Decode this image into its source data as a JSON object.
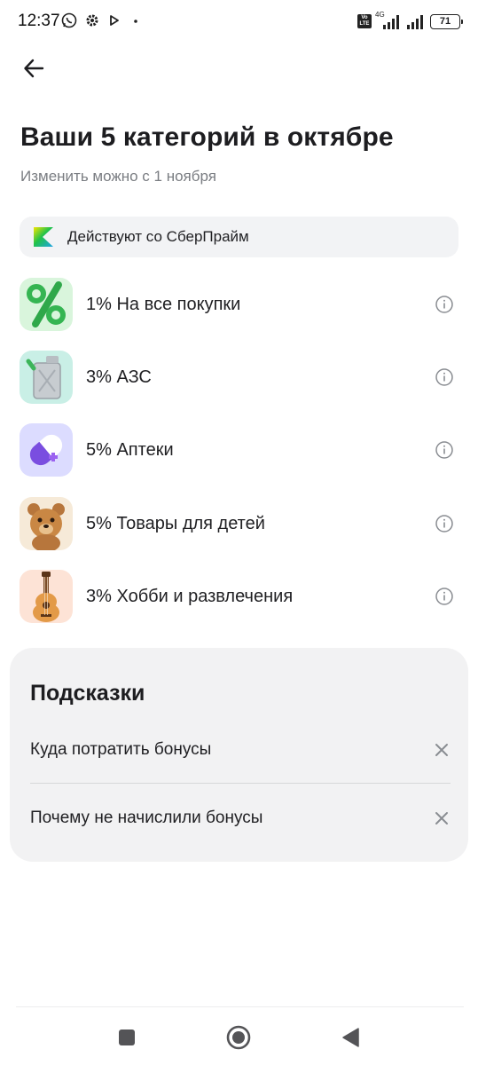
{
  "status_bar": {
    "time": "12:37",
    "network": "4G",
    "volte": "Vo LTE",
    "battery": "71",
    "icons": [
      "whatsapp-icon",
      "gear-icon",
      "play-icon",
      "dot-icon",
      "volte-icon",
      "signal-icon",
      "signal-icon",
      "battery-icon"
    ]
  },
  "header": {
    "back_icon": "arrow-left-icon",
    "title": "Ваши 5 категорий в октябре",
    "subtitle": "Изменить можно с 1 ноября"
  },
  "prime_chip": {
    "label": "Действуют со СберПрайм",
    "icon": "sberprime-logo-icon"
  },
  "categories": [
    {
      "label": "1% На все покупки",
      "icon": "percent-icon"
    },
    {
      "label": "3% АЗС",
      "icon": "fuel-canister-icon"
    },
    {
      "label": "5% Аптеки",
      "icon": "pill-icon"
    },
    {
      "label": "5% Товары для детей",
      "icon": "teddy-bear-icon"
    },
    {
      "label": "3% Хобби и развлечения",
      "icon": "guitar-icon"
    }
  ],
  "tips": {
    "title": "Подсказки",
    "items": [
      {
        "label": "Куда потратить бонусы"
      },
      {
        "label": "Почему не начислили бонусы"
      }
    ]
  },
  "nav_bar": {
    "icons": [
      "recents-square-icon",
      "home-circle-icon",
      "back-triangle-icon"
    ]
  },
  "colors": {
    "accent_green": "#21a038",
    "chip_bg": "#f2f3f5",
    "card_bg": "#f2f2f3",
    "subtitle_gray": "#7a7d82"
  }
}
